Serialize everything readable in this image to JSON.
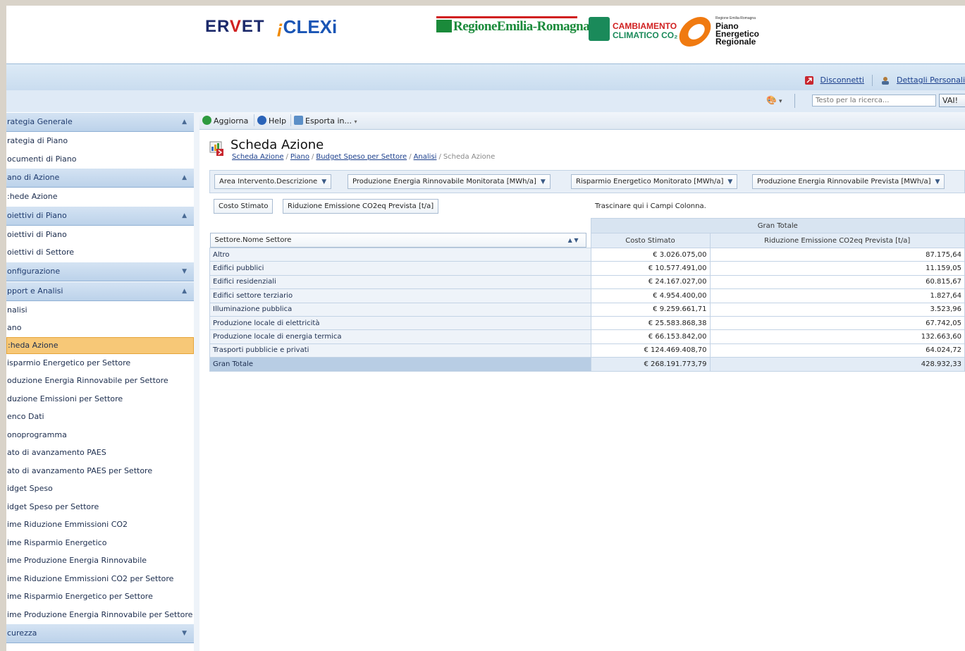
{
  "header": {
    "logo_ervet": "ERVET",
    "logo_ervet_v": "V",
    "logo_clexi": "CLEXi",
    "logo_region": "RegioneEmilia-Romagna",
    "logo_cc_line1": "CAMBIAMENTO",
    "logo_cc_line2": "CLIMATICO CO₂",
    "logo_per_small": "Regione Emilia-Romagna",
    "logo_per_line1": "Piano",
    "logo_per_line2": "Energetico",
    "logo_per_line3": "Regionale"
  },
  "topbar": {
    "disconnect": "Disconnetti",
    "details": "Dettagli Personali",
    "search_placeholder": "Testo per la ricerca...",
    "search_button": "VAI!"
  },
  "sidebar": {
    "groups": [
      {
        "label": "rategia Generale",
        "items": [
          "rategia di Piano",
          "ocumenti di Piano"
        ]
      },
      {
        "label": "ano di Azione",
        "items": [
          ":hede Azione"
        ]
      },
      {
        "label": "oiettivi di Piano",
        "items": [
          "oiettivi di Piano",
          "oiettivi di Settore"
        ]
      },
      {
        "label": "onfigurazione",
        "items": []
      },
      {
        "label": "pport e Analisi",
        "items": [
          "nalisi",
          "ano",
          ":heda Azione",
          "isparmio Energetico per Settore",
          "oduzione Energia Rinnovabile per Settore",
          "duzione Emissioni per Settore",
          "enco Dati",
          "onoprogramma",
          "ato di avanzamento PAES",
          "ato di avanzamento PAES per Settore",
          "idget Speso",
          "idget Speso per Settore",
          "ime Riduzione Emmissioni CO2",
          "ime Risparmio Energetico",
          "ime Produzione Energia Rinnovabile",
          "ime Riduzione Emmissioni CO2 per Settore",
          "ime Risparmio Energetico per Settore",
          "ime Produzione Energia Rinnovabile per Settore"
        ]
      },
      {
        "label": "curezza",
        "items": []
      }
    ]
  },
  "toolbar": {
    "refresh": "Aggiorna",
    "help": "Help",
    "export": "Esporta in...",
    "export_arrow": "▾"
  },
  "page": {
    "title": "Scheda Azione",
    "breadcrumb": [
      "Scheda Azione",
      "Piano",
      "Budget Speso per Settore",
      "Analisi"
    ],
    "breadcrumb_current": "Scheda Azione",
    "breadcrumb_sep": "/"
  },
  "pivot": {
    "filter_fields": [
      "Area Intervento.Descrizione",
      "Produzione Energia Rinnovabile Monitorata [MWh/a]",
      "Risparmio Energetico Monitorato [MWh/a]",
      "Produzione Energia Rinnovabile Prevista [MWh/a]"
    ],
    "data_fields": [
      "Costo Stimato",
      "Riduzione Emissione CO2eq Prevista [t/a]"
    ],
    "column_hint": "Trascinare qui i Campi Colonna.",
    "row_field": "Settore.Nome Settore",
    "grand_total_header": "Gran Totale",
    "columns": [
      "Costo Stimato",
      "Riduzione Emissione CO2eq Prevista [t/a]"
    ],
    "rows": [
      {
        "label": "Altro",
        "cost": "€ 3.026.075,00",
        "co2": "87.175,64"
      },
      {
        "label": "Edifici pubblici",
        "cost": "€ 10.577.491,00",
        "co2": "11.159,05"
      },
      {
        "label": "Edifici residenziali",
        "cost": "€ 24.167.027,00",
        "co2": "60.815,67"
      },
      {
        "label": "Edifici settore terziario",
        "cost": "€ 4.954.400,00",
        "co2": "1.827,64"
      },
      {
        "label": "Illuminazione pubblica",
        "cost": "€ 9.259.661,71",
        "co2": "3.523,96"
      },
      {
        "label": "Produzione locale di elettricità",
        "cost": "€ 25.583.868,38",
        "co2": "67.742,05"
      },
      {
        "label": "Produzione locale di energia termica",
        "cost": "€ 66.153.842,00",
        "co2": "132.663,60"
      },
      {
        "label": "Trasporti pubblicie e privati",
        "cost": "€ 124.469.408,70",
        "co2": "64.024,72"
      }
    ],
    "total": {
      "label": "Gran Totale",
      "cost": "€ 268.191.773,79",
      "co2": "428.932,33"
    }
  },
  "colors": {
    "accent": "#1b3f8c",
    "active_item": "#f7c877",
    "header_blue": "#c9dcef"
  }
}
